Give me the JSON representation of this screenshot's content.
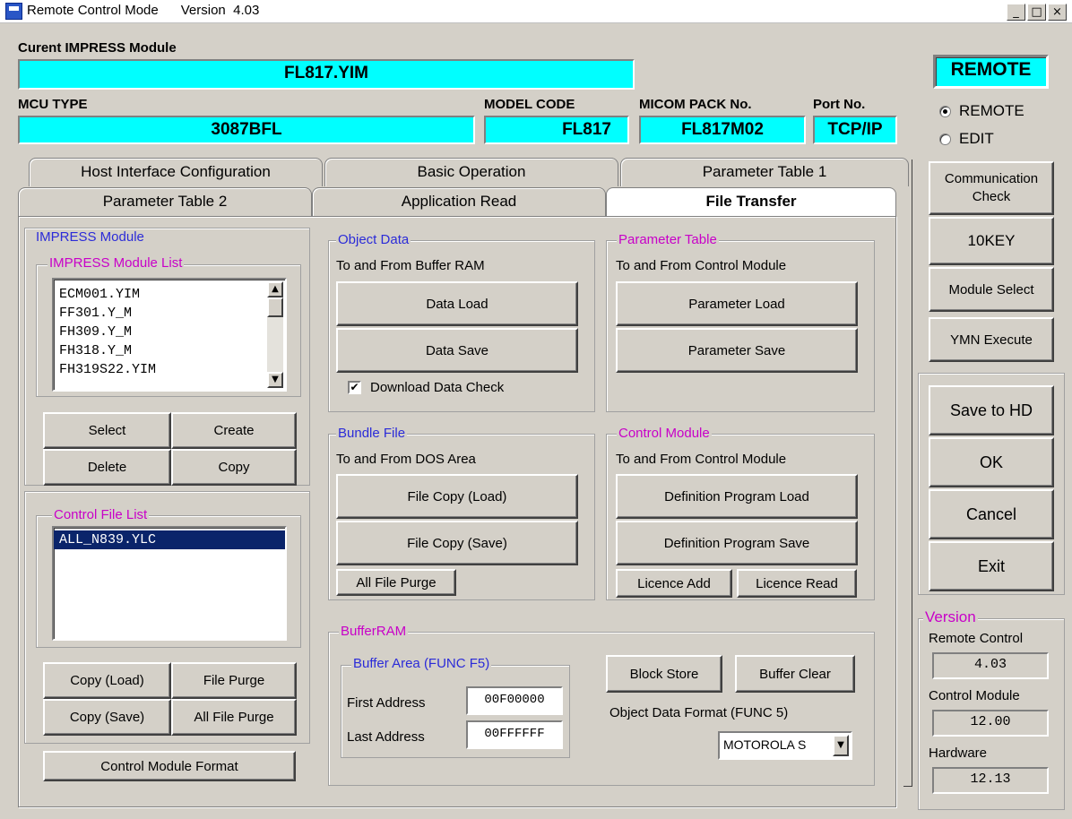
{
  "window": {
    "title": "Remote Control Mode      Version  4.03",
    "btn_min": "_",
    "btn_max": "□",
    "btn_close": "×"
  },
  "header": {
    "current_module_label": "Curent IMPRESS Module",
    "current_module_value": "FL817.YIM",
    "mcu_type_label": "MCU TYPE",
    "mcu_type_value": "3087BFL",
    "model_code_label": "MODEL CODE",
    "model_code_value": "FL817",
    "micom_pack_label": "MICOM PACK No.",
    "micom_pack_value": "FL817M02",
    "port_label": "Port No.",
    "port_value": "TCP/IP"
  },
  "mode": {
    "banner": "REMOTE",
    "radio_remote": "REMOTE",
    "radio_edit": "EDIT",
    "selected": "REMOTE"
  },
  "tabs": {
    "row1": [
      "Host Interface Configuration",
      "Basic Operation",
      "Parameter Table 1"
    ],
    "row2": [
      "Parameter Table 2",
      "Application Read",
      "File Transfer"
    ],
    "active": "File Transfer"
  },
  "impress": {
    "group_title": "IMPRESS Module",
    "list_title": "IMPRESS Module List",
    "items": [
      "ECM001.YIM",
      "FF301.Y_M",
      "FH309.Y_M",
      "FH318.Y_M",
      "FH319S22.YIM"
    ],
    "select": "Select",
    "create": "Create",
    "delete": "Delete",
    "copy": "Copy"
  },
  "control_file": {
    "title": "Control File List",
    "items": [
      "ALL_N839.YLC"
    ],
    "copy_load": "Copy (Load)",
    "file_purge": "File Purge",
    "copy_save": "Copy (Save)",
    "all_file_purge": "All File Purge",
    "format": "Control Module Format"
  },
  "object_data": {
    "title": "Object Data",
    "subtitle": "To and From Buffer RAM",
    "load": "Data Load",
    "save": "Data Save",
    "check_label": "Download Data Check",
    "check_mark": "✔"
  },
  "parameter_table": {
    "title": "Parameter Table",
    "subtitle": "To and From Control Module",
    "load": "Parameter Load",
    "save": "Parameter Save"
  },
  "bundle": {
    "title": "Bundle File",
    "subtitle": "To and From DOS Area",
    "copy_load": "File Copy (Load)",
    "copy_save": "File Copy (Save)",
    "purge": "All File Purge"
  },
  "control_module": {
    "title": "Control Module",
    "subtitle": "To and From Control Module",
    "def_load": "Definition Program Load",
    "def_save": "Definition Program Save",
    "licence_add": "Licence Add",
    "licence_read": "Licence Read"
  },
  "buffer": {
    "title": "BufferRAM",
    "area_title": "Buffer Area (FUNC F5)",
    "first_label": "First Address",
    "first_value": "00F00000",
    "last_label": "Last Address",
    "last_value": "00FFFFFF",
    "block_store": "Block Store",
    "buffer_clear": "Buffer Clear",
    "format_label": "Object Data Format (FUNC 5)",
    "format_value": "MOTOROLA S",
    "dropdown_arrow": "▼"
  },
  "side": {
    "comm_check": "Communication Check",
    "tenkey": "10KEY",
    "module_select": "Module Select",
    "ymn_execute": "YMN Execute",
    "save_hd": "Save to HD",
    "ok": "OK",
    "cancel": "Cancel",
    "exit": "Exit"
  },
  "version": {
    "title": "Version",
    "remote_label": "Remote Control",
    "remote_value": "4.03",
    "control_label": "Control Module",
    "control_value": "12.00",
    "hardware_label": "Hardware",
    "hardware_value": "12.13"
  }
}
